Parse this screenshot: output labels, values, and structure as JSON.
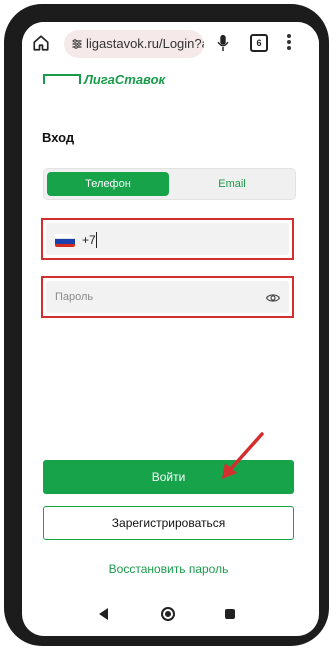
{
  "browser": {
    "url": "ligastavok.ru/Login?ac",
    "tab_count": "6",
    "icons": [
      "home-icon",
      "tune-icon",
      "mic-icon",
      "tabs-icon",
      "more-vert-icon"
    ]
  },
  "brand": {
    "name": "ЛигаСтавок",
    "color": "#1a9b4b"
  },
  "login": {
    "title": "Вход",
    "tabs": [
      {
        "label": "Телефон",
        "selected": true
      },
      {
        "label": "Email",
        "selected": false
      }
    ],
    "phone_prefix": "+7",
    "password_placeholder": "Пароль",
    "login_button": "Войти",
    "register_button": "Зарегистрироваться",
    "restore_link": "Восстановить пароль"
  },
  "colors": {
    "accent": "#16a34a",
    "highlight_outline": "#d32f2f",
    "field_bg": "#f2f2f2"
  }
}
